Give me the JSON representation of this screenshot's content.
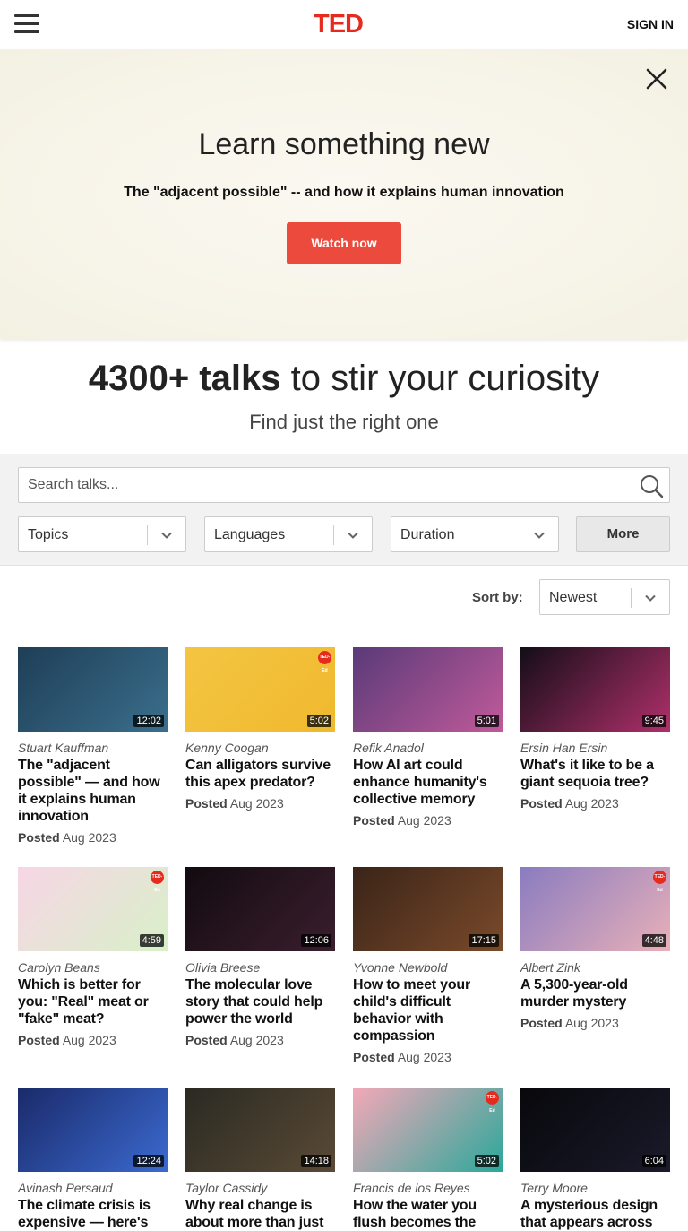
{
  "header": {
    "logo": "TED",
    "sign_in": "SIGN IN"
  },
  "hero": {
    "title": "Learn something new",
    "subtitle": "The \"adjacent possible\" -- and how it explains human innovation",
    "cta": "Watch now"
  },
  "intro": {
    "count_bold": "4300+ talks",
    "count_rest": " to stir your curiosity",
    "subhead": "Find just the right one"
  },
  "filters": {
    "search_placeholder": "Search talks...",
    "topics": "Topics",
    "languages": "Languages",
    "duration": "Duration",
    "more": "More"
  },
  "sort": {
    "label": "Sort by:",
    "value": "Newest"
  },
  "talks": [
    {
      "speaker": "Stuart Kauffman",
      "title": "The \"adjacent possible\" — and how it explains human innovation",
      "duration": "12:02",
      "posted_label": "Posted",
      "posted_date": "Aug 2023",
      "colors": [
        "#1f3e57",
        "#3a6f8c"
      ]
    },
    {
      "speaker": "Kenny Coogan",
      "title": "Can alligators survive this apex predator?",
      "duration": "5:02",
      "posted_label": "Posted",
      "posted_date": "Aug 2023",
      "colors": [
        "#f4c542",
        "#f0b92e"
      ]
    },
    {
      "speaker": "Refik Anadol",
      "title": "How AI art could enhance humanity's collective memory",
      "duration": "5:01",
      "posted_label": "Posted",
      "posted_date": "Aug 2023",
      "colors": [
        "#5a3a78",
        "#c05a9a"
      ]
    },
    {
      "speaker": "Ersin Han Ersin",
      "title": "What's it like to be a giant sequoia tree?",
      "duration": "9:45",
      "posted_label": "Posted",
      "posted_date": "Aug 2023",
      "colors": [
        "#140d18",
        "#b0306a"
      ]
    },
    {
      "speaker": "Carolyn Beans",
      "title": "Which is better for you: \"Real\" meat or \"fake\" meat?",
      "duration": "4:59",
      "posted_label": "Posted",
      "posted_date": "Aug 2023",
      "colors": [
        "#f7d6e6",
        "#d8f0c8"
      ]
    },
    {
      "speaker": "Olivia Breese",
      "title": "The molecular love story that could help power the world",
      "duration": "12:06",
      "posted_label": "Posted",
      "posted_date": "Aug 2023",
      "colors": [
        "#120b10",
        "#3b1e2e"
      ]
    },
    {
      "speaker": "Yvonne Newbold",
      "title": "How to meet your child's difficult behavior with compassion",
      "duration": "17:15",
      "posted_label": "Posted",
      "posted_date": "Aug 2023",
      "colors": [
        "#3a2418",
        "#7a4a2a"
      ]
    },
    {
      "speaker": "Albert Zink",
      "title": "A 5,300-year-old murder mystery",
      "duration": "4:48",
      "posted_label": "Posted",
      "posted_date": "Aug 2023",
      "colors": [
        "#8a7cc0",
        "#e8b0b8"
      ]
    },
    {
      "speaker": "Avinash Persaud",
      "title": "The climate crisis is expensive — here's",
      "duration": "12:24",
      "posted_label": "",
      "posted_date": "",
      "colors": [
        "#1a2a6a",
        "#3b6ad0"
      ]
    },
    {
      "speaker": "Taylor Cassidy",
      "title": "Why real change is about more than just",
      "duration": "14:18",
      "posted_label": "",
      "posted_date": "",
      "colors": [
        "#2a2a22",
        "#5a4a36"
      ]
    },
    {
      "speaker": "Francis de los Reyes",
      "title": "How the water you flush becomes the",
      "duration": "5:02",
      "posted_label": "",
      "posted_date": "",
      "colors": [
        "#f4a8b8",
        "#2aa89a"
      ]
    },
    {
      "speaker": "Terry Moore",
      "title": "A mysterious design that appears across",
      "duration": "6:04",
      "posted_label": "",
      "posted_date": "",
      "colors": [
        "#08080c",
        "#1a1a2a"
      ]
    }
  ]
}
